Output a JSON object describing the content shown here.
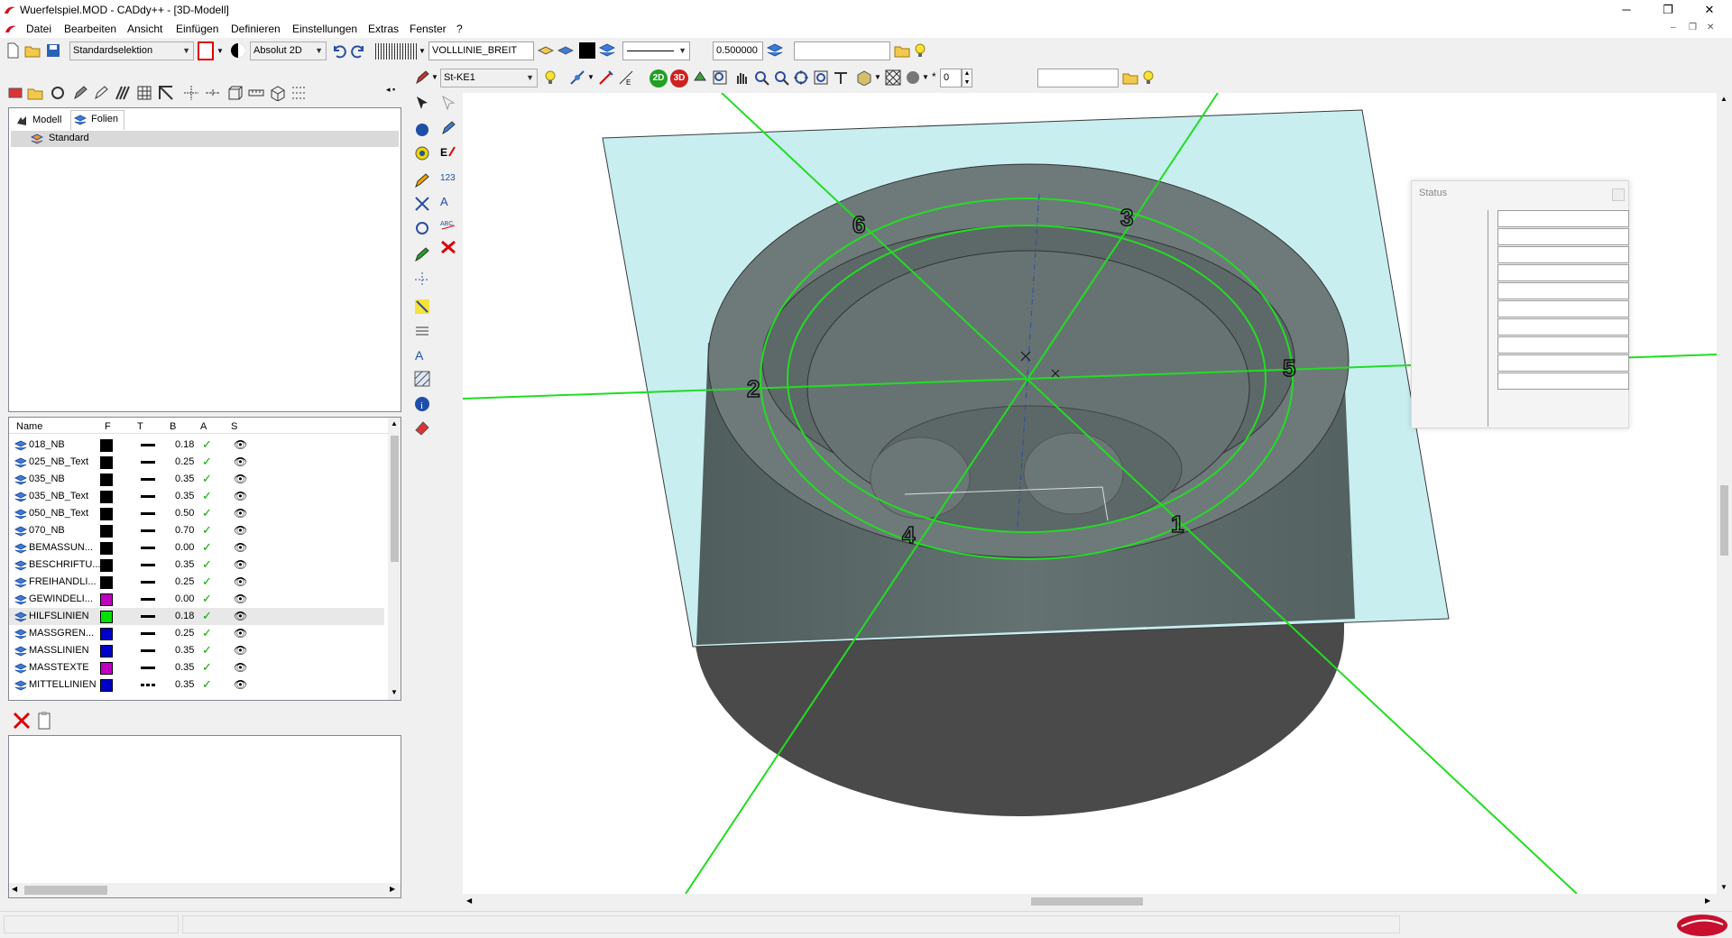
{
  "window": {
    "title": "Wuerfelspiel.MOD  -  CADdy++ - [3D-Modell]",
    "minimize": "─",
    "restore": "❐",
    "close": "✕"
  },
  "menu": [
    "Datei",
    "Bearbeiten",
    "Ansicht",
    "Einfügen",
    "Definieren",
    "Einstellungen",
    "Extras",
    "Fenster",
    "?"
  ],
  "mdi": {
    "minimize": "–",
    "restore": "❐",
    "close": "✕"
  },
  "toolbar1": {
    "selection_mode": "Standardselektion",
    "coord_mode": "Absolut 2D",
    "line_type": "VOLLLINIE_BREIT",
    "line_width": "0.500000",
    "search_value": ""
  },
  "toolbar2": {
    "layer_style": "St-KE1",
    "view_2d": "2D",
    "view_3d": "3D",
    "counter_value": "0",
    "search_value": ""
  },
  "left_panel": {
    "tabs": [
      "Modell",
      "Folien"
    ],
    "tree_items": [
      "Standard"
    ],
    "columns": [
      "Name",
      "F",
      "T",
      "B",
      "A",
      "S"
    ],
    "layers": [
      {
        "name": "018_NB",
        "color": "#000000",
        "line": "solid",
        "width": "0.18"
      },
      {
        "name": "025_NB_Text",
        "color": "#000000",
        "line": "solid",
        "width": "0.25"
      },
      {
        "name": "035_NB",
        "color": "#000000",
        "line": "solid",
        "width": "0.35"
      },
      {
        "name": "035_NB_Text",
        "color": "#000000",
        "line": "solid",
        "width": "0.35"
      },
      {
        "name": "050_NB_Text",
        "color": "#000000",
        "line": "solid",
        "width": "0.50"
      },
      {
        "name": "070_NB",
        "color": "#000000",
        "line": "solid",
        "width": "0.70"
      },
      {
        "name": "BEMASSUN...",
        "color": "#000000",
        "line": "solid",
        "width": "0.00"
      },
      {
        "name": "BESCHRIFTU...",
        "color": "#000000",
        "line": "solid",
        "width": "0.35"
      },
      {
        "name": "FREIHANDLI...",
        "color": "#000000",
        "line": "solid",
        "width": "0.25"
      },
      {
        "name": "GEWINDELI...",
        "color": "#c000c0",
        "line": "solid",
        "width": "0.00"
      },
      {
        "name": "HILFSLINIEN",
        "color": "#00e000",
        "line": "solid",
        "width": "0.18"
      },
      {
        "name": "MASSGREN...",
        "color": "#0000c8",
        "line": "solid",
        "width": "0.25"
      },
      {
        "name": "MASSLINIEN",
        "color": "#0000c8",
        "line": "solid",
        "width": "0.35"
      },
      {
        "name": "MASSTEXTE",
        "color": "#c000c0",
        "line": "solid",
        "width": "0.35"
      },
      {
        "name": "MITTELLINIEN",
        "color": "#0000c8",
        "line": "dash",
        "width": "0.35"
      }
    ]
  },
  "viewport": {
    "dice_labels": [
      "6",
      "3",
      "2",
      "5",
      "4",
      "1"
    ]
  },
  "status_window": {
    "title": "Status",
    "rows": 10
  },
  "colors": {
    "accent_red": "#c8102e",
    "plane": "#c8eef0",
    "body": "#5f6b6b",
    "guide": "#22dd22"
  }
}
